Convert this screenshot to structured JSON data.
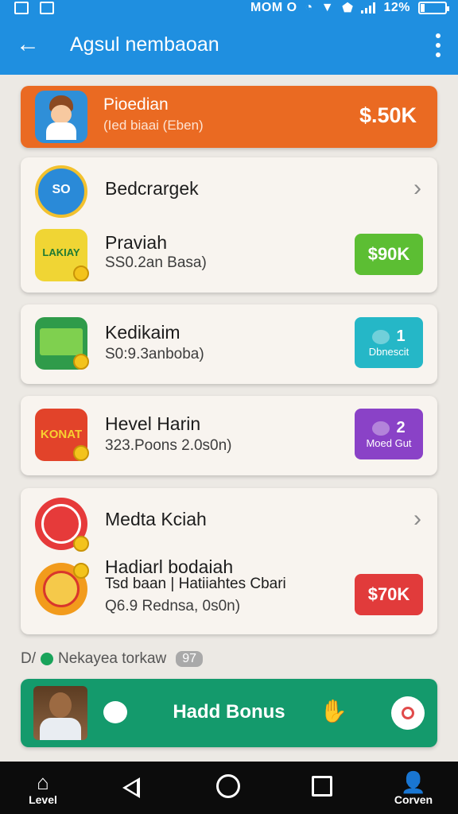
{
  "status_bar": {
    "carrier": "MOM O",
    "battery": "12%"
  },
  "app_bar": {
    "title": "Agsul nembaoan"
  },
  "top_banner": {
    "title": "Pioedian",
    "subtitle": "(Ied biaai (Eben)",
    "amount": "$.50K"
  },
  "card1": {
    "row1": {
      "name": "Bedcrargek",
      "icon_text": "SO"
    },
    "row2": {
      "name": "Praviah",
      "sub": "SS0.2an Basa)",
      "icon_text": "LAKIAY",
      "amount": "$90K"
    }
  },
  "card2": {
    "name": "Kedikaim",
    "sub": "S0:9.3anboba)",
    "badge_num": "1",
    "badge_text": "Dbnescit"
  },
  "card3": {
    "name": "Hevel Harin",
    "sub": "323.Poons 2.0s0n)",
    "icon_text": "KONAT",
    "badge_num": "2",
    "badge_text": "Moed Gut"
  },
  "card4": {
    "row1": {
      "name": "Medta Kciah"
    },
    "row2": {
      "name": "Hadiarl bodaiah",
      "sub1": "Tsd baan | Hatiiahtes Cbari",
      "sub2": "Q6.9 Rednsa, 0s0n)",
      "amount": "$70K"
    }
  },
  "section": {
    "prefix": "D/",
    "label": "Nekayea torkaw",
    "count": "97"
  },
  "bonus": {
    "label": "Hadd Bonus"
  },
  "navbar": {
    "left_label": "Level",
    "right_label": "Corven"
  },
  "colors": {
    "primary": "#1f8fe0",
    "orange": "#ea6a22",
    "green_pill": "#5cbe33",
    "teal_pill": "#25b7c7",
    "purple_pill": "#8a42c7",
    "red_pill": "#e13b3b",
    "bonus": "#149a6c"
  }
}
